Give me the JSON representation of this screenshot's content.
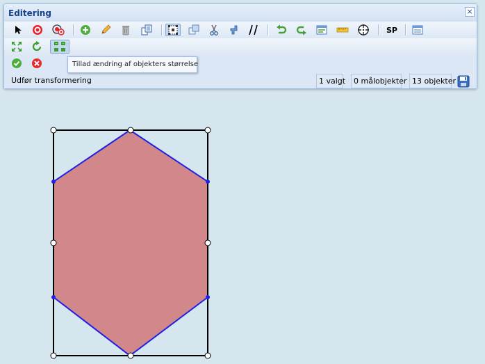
{
  "panel": {
    "title": "Editering",
    "close_label": "×"
  },
  "toolbar": {
    "row1": [
      {
        "name": "select-arrow-icon"
      },
      {
        "name": "target-icon"
      },
      {
        "name": "multi-target-icon"
      },
      {
        "name": "add-icon"
      },
      {
        "name": "edit-pencil-icon"
      },
      {
        "name": "delete-bin-icon"
      },
      {
        "name": "copy-icon"
      },
      {
        "name": "transform-grid-icon",
        "active": true
      },
      {
        "name": "overlay-icon"
      },
      {
        "name": "scissors-icon"
      },
      {
        "name": "merge-icon"
      },
      {
        "name": "parallel-lines-icon"
      },
      {
        "name": "undo-icon"
      },
      {
        "name": "redo-icon"
      },
      {
        "name": "table-edit-icon"
      },
      {
        "name": "ruler-icon"
      },
      {
        "name": "crosshair-icon"
      },
      {
        "name": "sp-button",
        "label": "SP"
      },
      {
        "name": "list-icon"
      }
    ],
    "row2": [
      {
        "name": "scale-arrows-icon"
      },
      {
        "name": "rotate-icon"
      },
      {
        "name": "resize-grid-icon",
        "active": true
      }
    ],
    "row3": [
      {
        "name": "confirm-icon"
      },
      {
        "name": "cancel-icon"
      }
    ]
  },
  "tooltip": "Tillad ændring af objekters størrelse",
  "status": {
    "label": "Udfør transformering",
    "selected": "1 valgt",
    "targets": "0 målobjekter",
    "objects": "13 objekter"
  },
  "colors": {
    "background": "#d6e6ee",
    "fill": "#d2888b",
    "stroke": "#1f1fe6",
    "accent": "#15428b"
  }
}
